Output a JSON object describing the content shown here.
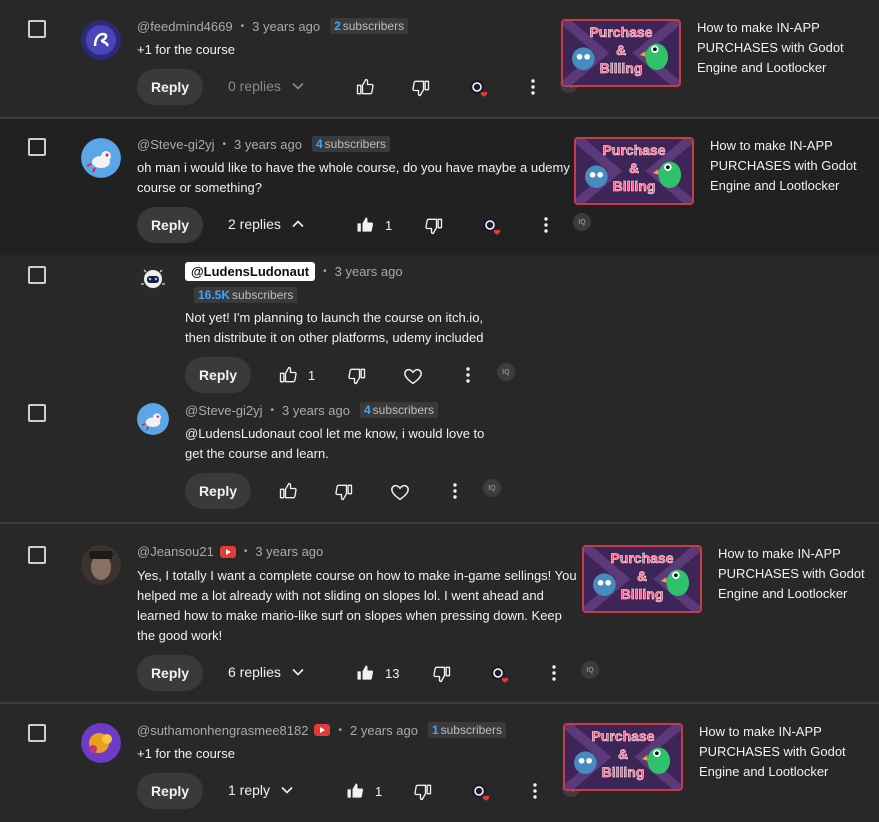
{
  "common": {
    "reply_label": "Reply",
    "video_title": "How to make IN-APP PURCHASES with Godot Engine and Lootlocker",
    "iq_label": "IQ",
    "thumb_line1": "Purchase",
    "thumb_line2": "&",
    "thumb_line3": "Billing"
  },
  "colors": {
    "accent": "#3ea6ff",
    "bg": "#282828",
    "reply_bg": "#3a3a3a",
    "heart": "#e53935"
  },
  "comments": [
    {
      "author": "@feedmind4669",
      "time": "3 years ago",
      "subs_count": "2",
      "subs_label": "subscribers",
      "text": "+1 for the course",
      "replies": "0 replies",
      "likes": ""
    },
    {
      "author": "@Steve-gi2yj",
      "time": "3 years ago",
      "subs_count": "4",
      "subs_label": "subscribers",
      "text_l1": "oh man i would like to have the whole course, do you have maybe a udemy",
      "text_l2": "course or something?",
      "replies": "2 replies",
      "likes": "1"
    },
    {
      "author": "@LudensLudonaut",
      "time": "3 years ago",
      "subs_count": "16.5K",
      "subs_label": "subscribers",
      "text_l1": "Not yet! I'm planning to launch the course on itch.io,",
      "text_l2": "then distribute it on other platforms, udemy included",
      "likes": "1"
    },
    {
      "author": "@Steve-gi2yj",
      "time": "3 years ago",
      "subs_count": "4",
      "subs_label": "subscribers",
      "text_l1": "@LudensLudonaut cool let me know, i would love to",
      "text_l2": "get the course and learn.",
      "likes": ""
    },
    {
      "author": "@Jeansou21",
      "time": "3 years ago",
      "text_l1": "Yes, I totally I want a complete course on how to make in-game sellings! You",
      "text_l2": "helped me a lot already with not sliding on slopes lol. I went ahead and",
      "text_l3": "learned how to make mario-like surf on slopes when pressing down. Keep",
      "text_l4": "the good work!",
      "replies": "6 replies",
      "likes": "13"
    },
    {
      "author": "@suthamonhengrasmee8182",
      "time": "2 years ago",
      "subs_count": "1",
      "subs_label": "subscribers",
      "text": "+1 for the course",
      "replies": "1 reply",
      "likes": "1"
    }
  ],
  "icons": [
    "checkbox-icon",
    "like-icon",
    "dislike-icon",
    "heart-icon",
    "more-icon",
    "chevron-down-icon",
    "chevron-up-icon",
    "youtube-badge-icon"
  ]
}
